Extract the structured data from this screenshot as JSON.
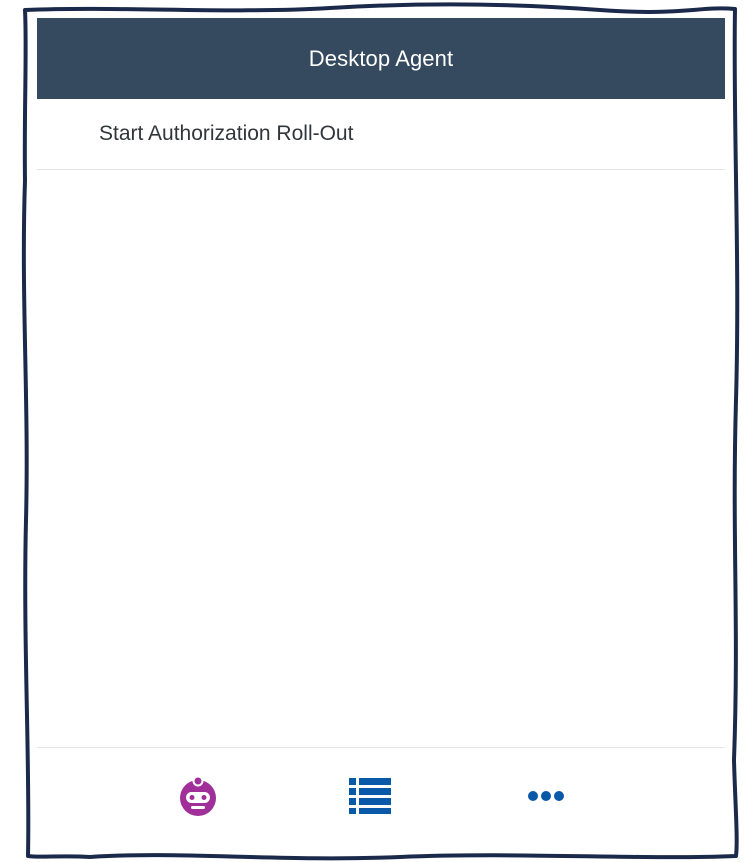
{
  "header": {
    "title": "Desktop Agent"
  },
  "list": {
    "items": [
      {
        "label": "Start Authorization Roll-Out"
      }
    ]
  },
  "footer": {
    "buttons": [
      {
        "icon": "agent-robot-icon",
        "color": "#a12f9a"
      },
      {
        "icon": "list-icon",
        "color": "#0a58a8"
      },
      {
        "icon": "more-dots-icon",
        "color": "#0a58a8"
      }
    ]
  },
  "colors": {
    "header_bg": "#354a5f",
    "frame": "#1b2a4a",
    "agent_accent": "#a12f9a",
    "action_blue": "#0a58a8"
  }
}
